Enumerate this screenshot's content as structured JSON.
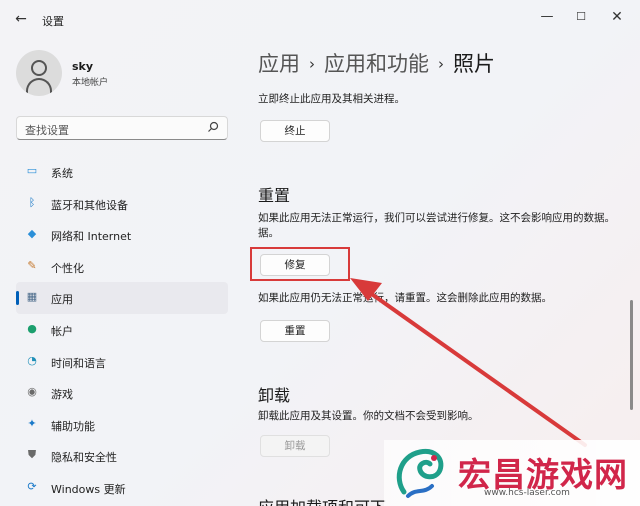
{
  "window": {
    "title": "设置",
    "back_glyph": "←",
    "minimize_glyph": "—",
    "maximize_glyph": "☐",
    "close_glyph": "✕"
  },
  "profile": {
    "name": "sky",
    "account_type": "本地帐户"
  },
  "search": {
    "placeholder": "查找设置",
    "icon": "search-icon"
  },
  "sidebar": {
    "items": [
      {
        "label": "系统",
        "icon": "system-icon",
        "color": "#2b8fd8"
      },
      {
        "label": "蓝牙和其他设备",
        "icon": "bluetooth-icon",
        "color": "#0a6fc2"
      },
      {
        "label": "网络和 Internet",
        "icon": "wifi-icon",
        "color": "#2b8fd8"
      },
      {
        "label": "个性化",
        "icon": "brush-icon",
        "color": "#c4772b"
      },
      {
        "label": "应用",
        "icon": "apps-icon",
        "color": "#4a6a8a",
        "active": true
      },
      {
        "label": "帐户",
        "icon": "account-icon",
        "color": "#1c9f6e"
      },
      {
        "label": "时间和语言",
        "icon": "globe-clock-icon",
        "color": "#1f8fb8"
      },
      {
        "label": "游戏",
        "icon": "gamepad-icon",
        "color": "#6a6a6a"
      },
      {
        "label": "辅助功能",
        "icon": "accessibility-icon",
        "color": "#1a79c9"
      },
      {
        "label": "隐私和安全性",
        "icon": "shield-icon",
        "color": "#6a6a6a"
      },
      {
        "label": "Windows 更新",
        "icon": "update-icon",
        "color": "#1a79c9"
      }
    ]
  },
  "breadcrumb": {
    "crumb1": "应用",
    "crumb2": "应用和功能",
    "current": "照片",
    "separator": "›"
  },
  "terminate": {
    "description": "立即终止此应用及其相关进程。",
    "button": "终止"
  },
  "reset": {
    "title": "重置",
    "repair_description_line1": "如果此应用无法正常运行，我们可以尝试进行修复。这不会影响应用的数据。",
    "repair_description_line2": "据。",
    "repair_button": "修复",
    "reset_description": "如果此应用仍无法正常运行，请重置。这会删除此应用的数据。",
    "reset_button": "重置"
  },
  "uninstall": {
    "title": "卸载",
    "description": "卸载此应用及其设置。你的文档不会受到影响。",
    "button": "卸载"
  },
  "cut_off_title": "应用加载项和可下",
  "watermark": {
    "text": "宏昌游戏网",
    "url": "www.hcs-laser.com"
  },
  "colors": {
    "accent": "#005fb8",
    "highlight": "#d83a3a",
    "watermark": "#d1264a"
  }
}
